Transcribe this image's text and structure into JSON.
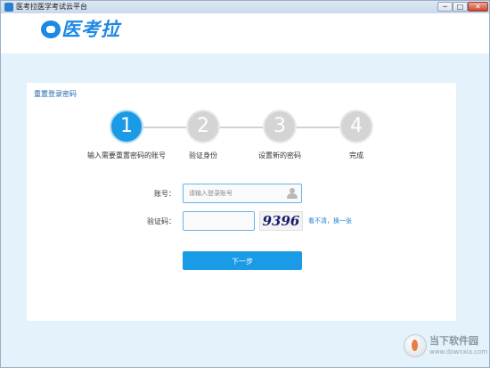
{
  "window": {
    "title": "医考拉医学考试云平台",
    "controls": {
      "minimize": "─",
      "maximize": "□",
      "close": "✕"
    }
  },
  "header": {
    "logo_text": "医考拉"
  },
  "panel": {
    "title": "重置登录密码"
  },
  "steps": [
    {
      "number": "1",
      "label": "输入需要重置密码的账号",
      "state": "active"
    },
    {
      "number": "2",
      "label": "验证身份",
      "state": "inactive"
    },
    {
      "number": "3",
      "label": "设置新的密码",
      "state": "inactive"
    },
    {
      "number": "4",
      "label": "完成",
      "state": "inactive"
    }
  ],
  "form": {
    "account_label": "账号：",
    "account_placeholder": "请输入登录账号",
    "account_value": "",
    "captcha_label": "验证码：",
    "captcha_value": "",
    "captcha_image_text": "9396",
    "refresh_link": "看不清，换一张",
    "next_button": "下一步"
  },
  "watermark": {
    "name": "当下软件园",
    "url": "www.downxia.com"
  },
  "colors": {
    "accent": "#1b9ae6",
    "background": "#e3f2fb",
    "step_inactive": "#d4d4d4",
    "link": "#1f7fd6"
  }
}
